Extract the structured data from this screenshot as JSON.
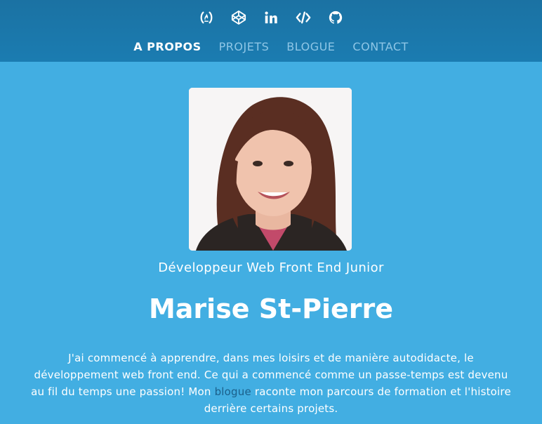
{
  "social": [
    {
      "icon": "freecodecamp-icon"
    },
    {
      "icon": "codepen-icon"
    },
    {
      "icon": "linkedin-icon"
    },
    {
      "icon": "code-icon"
    },
    {
      "icon": "github-icon"
    }
  ],
  "nav": {
    "items": [
      {
        "label": "A PROPOS",
        "active": true
      },
      {
        "label": "PROJETS",
        "active": false
      },
      {
        "label": "BLOGUE",
        "active": false
      },
      {
        "label": "CONTACT",
        "active": false
      }
    ]
  },
  "profile": {
    "subtitle": "Développeur Web Front End Junior",
    "name": "Marise St-Pierre",
    "bio_before": "J'ai commencé à apprendre, dans mes loisirs et de manière autodidacte, le développement web front end. Ce qui a commencé comme un passe-temps est devenu au fil du temps une passion! Mon ",
    "bio_link": "blogue",
    "bio_after": " raconte mon parcours de formation et l'histoire derrière certains projets."
  },
  "colors": {
    "background": "#42aee2",
    "header": "#1b7cb1",
    "nav_inactive": "#8ec6e6",
    "link": "#1b5f8a"
  }
}
